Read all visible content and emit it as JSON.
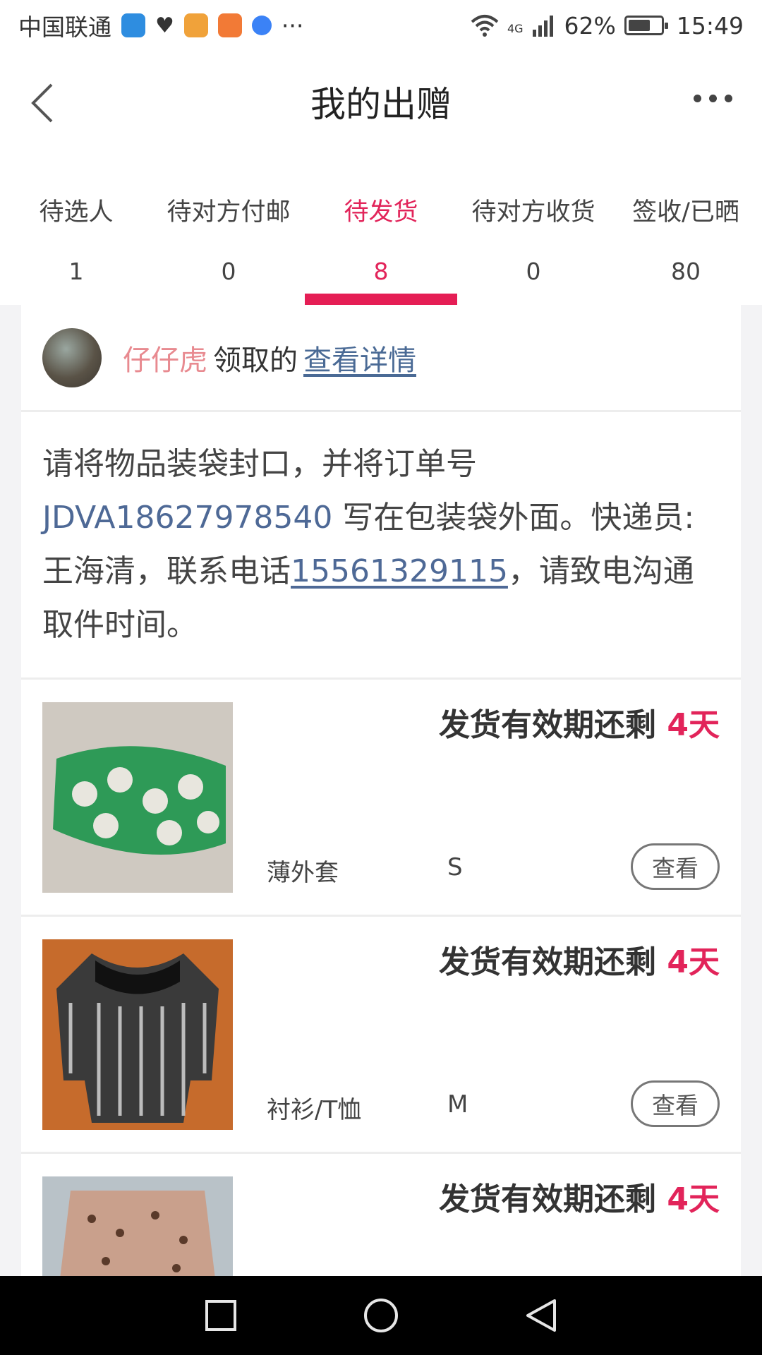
{
  "status_bar": {
    "carrier": "中国联通",
    "dots": "···",
    "network": "4G",
    "battery": "62%",
    "time": "15:49",
    "icons": [
      "shield-icon",
      "heart-icon",
      "app-icon",
      "video-icon",
      "chat-icon",
      "wifi-icon",
      "signal-icon",
      "battery-icon"
    ]
  },
  "header": {
    "title": "我的出赠",
    "back_icon": "back-icon",
    "more_icon": "more-icon"
  },
  "tabs": [
    {
      "label": "待选人",
      "count": "1"
    },
    {
      "label": "待对方付邮",
      "count": "0"
    },
    {
      "label": "待发货",
      "count": "8",
      "active": true
    },
    {
      "label": "待对方收货",
      "count": "0"
    },
    {
      "label": "签收/已晒",
      "count": "80"
    }
  ],
  "colors": {
    "accent": "#e2245a",
    "link": "#4e6996",
    "name": "#e88a90"
  },
  "receiver": {
    "name": "仔仔虎",
    "action": "领取的",
    "link": "查看详情"
  },
  "notice": {
    "part1": "请将物品装袋封口，并将订单号 ",
    "order_no": "JDVA18627978540",
    "part2": " 写在包装袋外面。快递员:王海清，联系电话",
    "phone": "15561329115",
    "part3": "，请致电沟通取件时间。"
  },
  "items": [
    {
      "deadline_label": "发货有效期还剩 ",
      "days": "4天",
      "category": "薄外套",
      "size": "S",
      "button": "查看"
    },
    {
      "deadline_label": "发货有效期还剩 ",
      "days": "4天",
      "category": "衬衫/T恤",
      "size": "M",
      "button": "查看"
    },
    {
      "deadline_label": "发货有效期还剩 ",
      "days": "4天",
      "category": "",
      "size": "",
      "button": ""
    }
  ]
}
